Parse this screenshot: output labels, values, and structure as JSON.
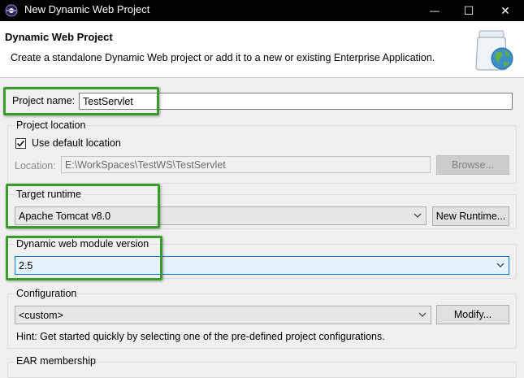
{
  "window": {
    "title": "New Dynamic Web Project",
    "minimize_glyph": "—",
    "maximize_glyph": "☐",
    "close_glyph": "✕"
  },
  "banner": {
    "title": "Dynamic Web Project",
    "description": "Create a standalone Dynamic Web project or add it to a new or existing Enterprise Application.",
    "icon": "jar-globe-icon"
  },
  "project_name": {
    "label": "Project name:",
    "value": "TestServlet"
  },
  "project_location": {
    "group_label": "Project location",
    "use_default_label": "Use default location",
    "use_default_checked": true,
    "location_label": "Location:",
    "location_value": "E:\\WorkSpaces\\TestWS\\TestServlet",
    "browse_label": "Browse..."
  },
  "target_runtime": {
    "group_label": "Target runtime",
    "selected": "Apache Tomcat v8.0",
    "new_runtime_label": "New Runtime..."
  },
  "module_version": {
    "group_label": "Dynamic web module version",
    "selected": "2.5"
  },
  "configuration": {
    "group_label": "Configuration",
    "selected": "<custom>",
    "modify_label": "Modify...",
    "hint": "Hint: Get started quickly by selecting one of the pre-defined project configurations."
  },
  "ear_membership": {
    "group_label": "EAR membership"
  },
  "colors": {
    "highlight_border": "#3a9a2c",
    "titlebar_bg": "#000000",
    "focus_blue": "#0078d7"
  }
}
